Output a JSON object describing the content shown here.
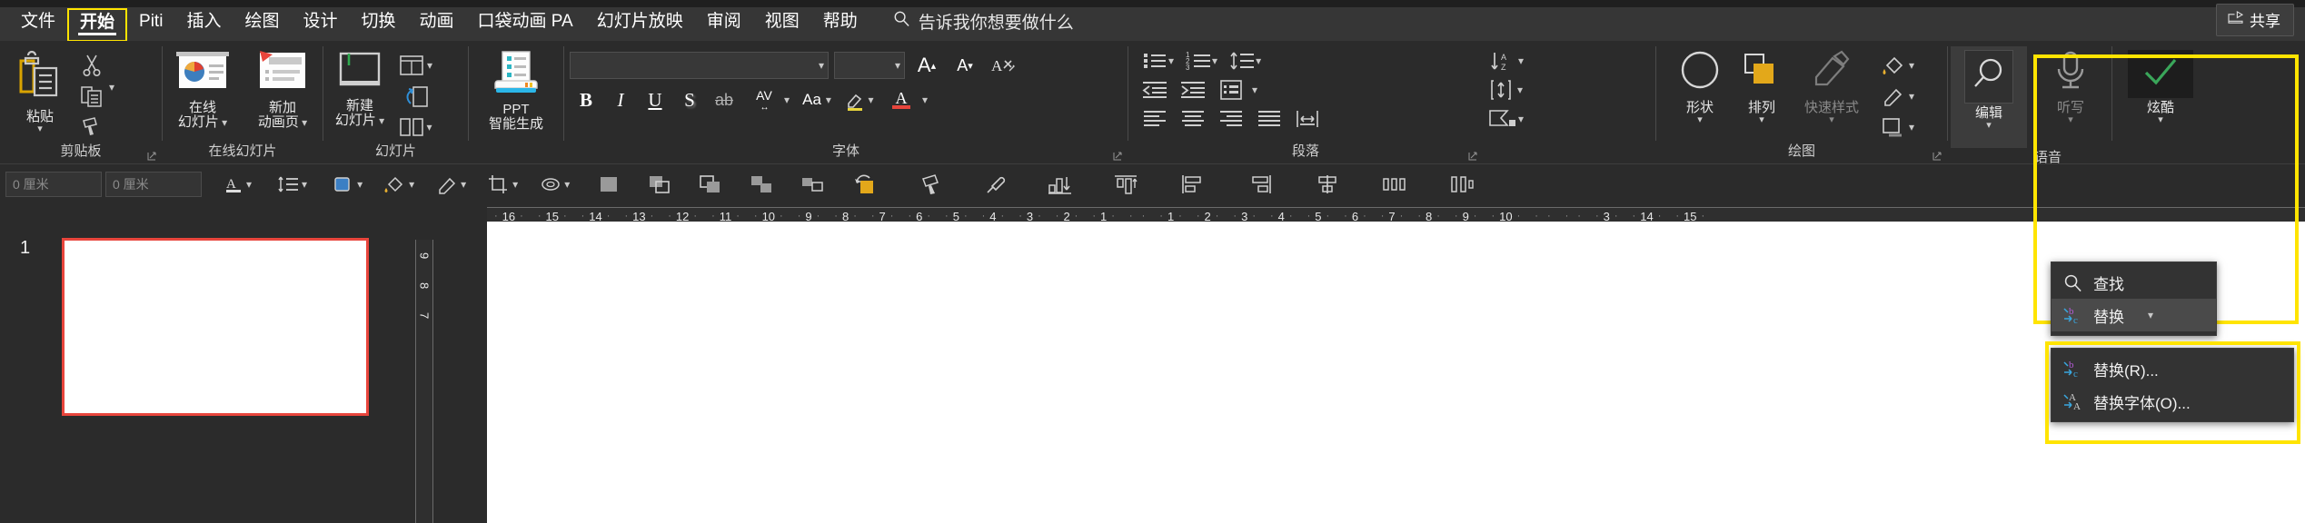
{
  "app": {
    "title": "PowerPoint",
    "accent_yellow": "#ffe400",
    "bg": "#2b2b2b"
  },
  "tabs": [
    {
      "label": "文件",
      "selected": false
    },
    {
      "label": "开始",
      "selected": true
    },
    {
      "label": "Piti",
      "selected": false
    },
    {
      "label": "插入",
      "selected": false
    },
    {
      "label": "绘图",
      "selected": false
    },
    {
      "label": "设计",
      "selected": false
    },
    {
      "label": "切换",
      "selected": false
    },
    {
      "label": "动画",
      "selected": false
    },
    {
      "label": "口袋动画 PA",
      "selected": false
    },
    {
      "label": "幻灯片放映",
      "selected": false
    },
    {
      "label": "审阅",
      "selected": false
    },
    {
      "label": "视图",
      "selected": false
    },
    {
      "label": "帮助",
      "selected": false
    }
  ],
  "tellme": {
    "label": "告诉我你想要做什么",
    "icon": "search-icon"
  },
  "share": {
    "label": "共享",
    "icon": "share-icon"
  },
  "ribbon": {
    "clipboard": {
      "group_label": "剪贴板",
      "paste_label": "粘贴",
      "cut_name": "cut-icon",
      "copy_name": "copy-icon",
      "format_painter_name": "format-painter-icon"
    },
    "online_slides": {
      "group_label": "在线幻灯片",
      "items": [
        {
          "line1": "在线",
          "line2": "幻灯片",
          "caret": true
        },
        {
          "line1": "新加",
          "line2": "动画页",
          "caret": true
        }
      ]
    },
    "slides": {
      "group_label": "幻灯片",
      "new_slide": {
        "line1": "新建",
        "line2": "幻灯片",
        "caret": true
      },
      "layout_name": "slide-layout-icon",
      "reset_name": "slide-reset-icon",
      "section_name": "slide-section-icon"
    },
    "ppt_ai": {
      "line1": "PPT",
      "line2": "智能生成"
    },
    "font": {
      "group_label": "字体",
      "font_name_value": "",
      "font_size_value": "",
      "grow_font": "A",
      "shrink_font": "A",
      "clear_format_name": "clear-formatting-icon",
      "bold": "B",
      "italic": "I",
      "underline": "U",
      "shadow": "S",
      "strikethrough": "ab",
      "char_spacing": "AV",
      "change_case": "Aa",
      "highlight_name": "text-highlight-icon",
      "font_color_name": "font-color-icon"
    },
    "paragraph": {
      "group_label": "段落",
      "bullets_name": "bullet-list-icon",
      "numbering_name": "numbered-list-icon",
      "line_spacing_name": "line-spacing-icon",
      "decrease_indent_name": "decrease-indent-icon",
      "increase_indent_name": "increase-indent-icon",
      "columns_name": "columns-icon",
      "align_left_name": "align-left-icon",
      "align_center_name": "align-center-icon",
      "align_right_name": "align-right-icon",
      "justify_name": "justify-icon",
      "text_direction_name": "text-direction-icon",
      "align_text_name": "align-text-icon",
      "smartart_name": "convert-smartart-icon",
      "vertical_align_name": "vertical-align-icon"
    },
    "drawing": {
      "group_label": "绘图",
      "shapes": {
        "label": "形状",
        "caret": true
      },
      "arrange": {
        "label": "排列",
        "caret": true
      },
      "quick_styles": {
        "label": "快速样式",
        "caret": true,
        "disabled": true
      },
      "shape_fill_name": "shape-fill-icon",
      "shape_outline_name": "shape-outline-icon",
      "shape_effects_name": "shape-effects-icon"
    },
    "voice": {
      "group_label": "语音",
      "edit": {
        "label": "编辑",
        "icon": "search-icon",
        "caret": true,
        "active": true
      },
      "dictate": {
        "label": "听写",
        "icon": "microphone-icon",
        "caret": true,
        "disabled": true
      }
    },
    "xuanku": {
      "label": "炫酷",
      "icon": "green-check-icon",
      "caret": true
    }
  },
  "toolbar2": {
    "size_h_value": "0 厘米",
    "size_h_placeholder": "0 厘米",
    "size_w_value": "0 厘米",
    "size_w_placeholder": "0 厘米",
    "buttons": [
      {
        "name": "font-color-icon",
        "caret": true
      },
      {
        "name": "line-spacing-icon",
        "caret": true
      },
      {
        "name": "shape-style-icon",
        "caret": true
      },
      {
        "name": "shape-fill-icon",
        "caret": true
      },
      {
        "name": "shape-outline-icon",
        "caret": true
      },
      {
        "name": "crop-icon",
        "caret": true
      },
      {
        "name": "shape-effects-icon",
        "caret": true
      },
      {
        "name": "selection-pane-icon",
        "caret": false
      },
      {
        "name": "bring-forward-icon",
        "caret": false
      },
      {
        "name": "send-backward-icon",
        "caret": false
      },
      {
        "name": "group-objects-icon",
        "caret": false
      },
      {
        "name": "ungroup-objects-icon",
        "caret": false
      },
      {
        "name": "rotate-icon",
        "caret": false
      },
      {
        "name": "format-painter-icon",
        "caret": false
      },
      {
        "name": "eyedropper-icon",
        "caret": false
      },
      {
        "name": "align-distribute-icon",
        "caret": false
      },
      {
        "name": "align-top-icon",
        "caret": false
      },
      {
        "name": "align-left-objects-icon",
        "caret": false
      },
      {
        "name": "align-right-objects-icon",
        "caret": false
      },
      {
        "name": "align-center-objects-icon",
        "caret": false
      },
      {
        "name": "distribute-horizontal-icon",
        "caret": false
      },
      {
        "name": "distribute-vertical-icon",
        "caret": false
      }
    ]
  },
  "ruler": {
    "h_ticks": [
      "16",
      "15",
      "14",
      "13",
      "12",
      "11",
      "10",
      "9",
      "8",
      "7",
      "6",
      "5",
      "4",
      "3",
      "2",
      "1",
      "",
      "1",
      "2",
      "3",
      "4",
      "5",
      "6",
      "7",
      "8",
      "9",
      "10",
      "",
      "",
      "3",
      "14",
      "15"
    ],
    "v_ticks": [
      "9",
      "8",
      "7"
    ]
  },
  "slide_panel": {
    "slide_number": "1"
  },
  "edit_menu": {
    "items": [
      {
        "label": "查找",
        "icon": "search-icon",
        "caret": false,
        "highlighted": false
      },
      {
        "label": "替换",
        "icon": "replace-icon",
        "caret": true,
        "highlighted": true
      }
    ]
  },
  "replace_submenu": {
    "items": [
      {
        "label": "替换(R)...",
        "icon": "replace-icon"
      },
      {
        "label": "替换字体(O)...",
        "icon": "replace-font-icon"
      }
    ]
  }
}
